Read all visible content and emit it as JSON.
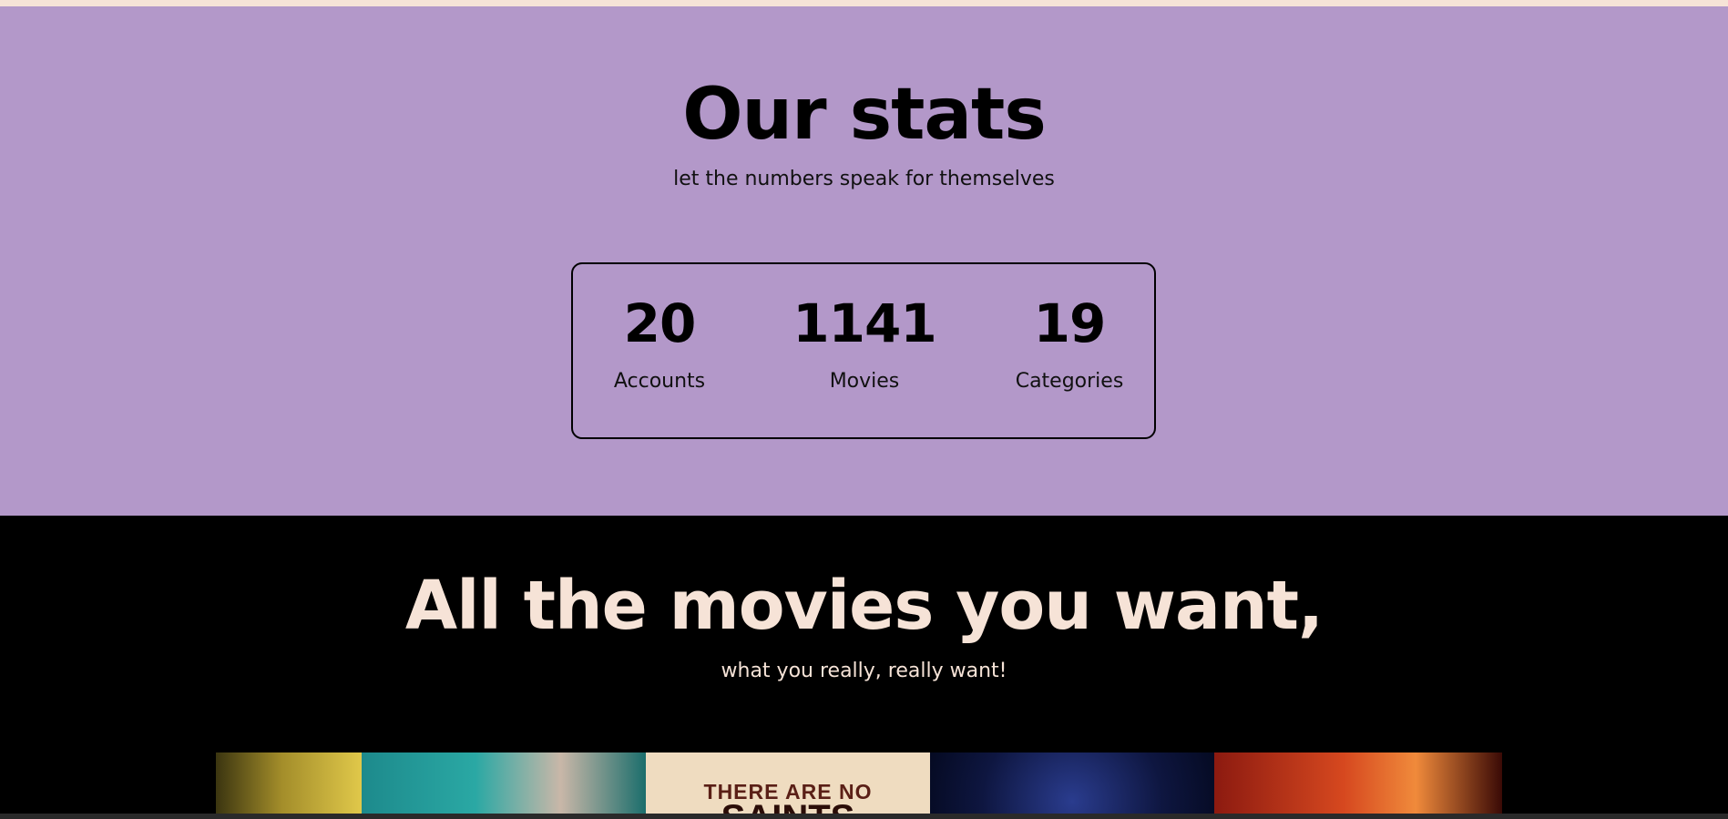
{
  "stats_section": {
    "title": "Our stats",
    "subtitle": "let the numbers speak for themselves",
    "items": [
      {
        "value": "20",
        "label": "Accounts"
      },
      {
        "value": "1141",
        "label": "Movies"
      },
      {
        "value": "19",
        "label": "Categories"
      }
    ]
  },
  "movies_section": {
    "title": "All the movies you want,",
    "subtitle": "what you really, really want!",
    "posters": [
      {
        "text": ""
      },
      {
        "text": ""
      },
      {
        "text": "THERE ARE NO",
        "text2": "SAINTS"
      },
      {
        "text": ""
      },
      {
        "text": ""
      }
    ]
  },
  "colors": {
    "stats_background": "#b398c9",
    "movies_background": "#000000",
    "accent_cream": "#f6e3d7"
  }
}
